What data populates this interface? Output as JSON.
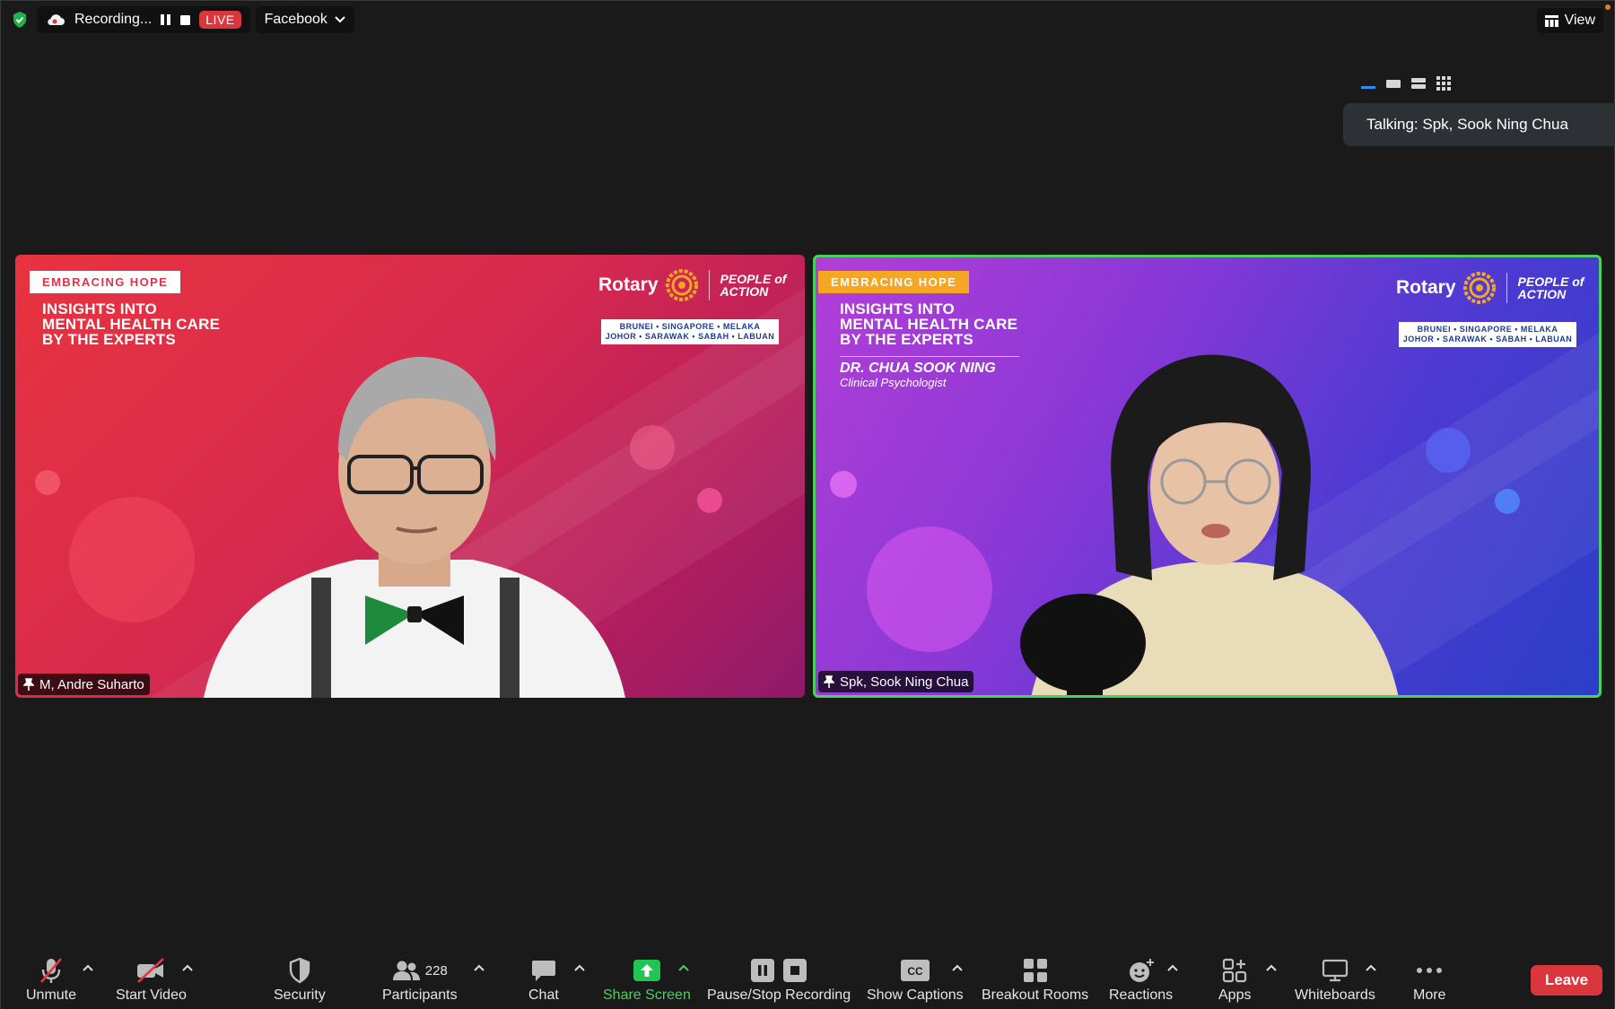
{
  "topbar": {
    "recording_label": "Recording...",
    "live_label": "LIVE",
    "stream_target": "Facebook",
    "view_label": "View"
  },
  "talking": {
    "text": "Talking: Spk, Sook Ning Chua"
  },
  "tiles": [
    {
      "name": "M, Andre Suharto",
      "tag": "EMBRACING HOPE",
      "headline": [
        "INSIGHTS INTO",
        "MENTAL HEALTH CARE",
        "BY THE EXPERTS"
      ],
      "brand": "Rotary",
      "brand_tag": [
        "PEOPLE of",
        "ACTION"
      ],
      "regions": [
        "BRUNEI • SINGAPORE • MELAKA",
        "JOHOR • SARAWAK • SABAH • LABUAN"
      ],
      "active": false
    },
    {
      "name": "Spk, Sook Ning Chua",
      "tag": "EMBRACING HOPE",
      "headline": [
        "INSIGHTS INTO",
        "MENTAL HEALTH CARE",
        "BY THE EXPERTS"
      ],
      "speaker_title": "DR. CHUA SOOK NING",
      "speaker_role": "Clinical Psychologist",
      "brand": "Rotary",
      "brand_tag": [
        "PEOPLE of",
        "ACTION"
      ],
      "regions": [
        "BRUNEI • SINGAPORE • MELAKA",
        "JOHOR • SARAWAK • SABAH • LABUAN"
      ],
      "active": true
    }
  ],
  "toolbar": {
    "unmute": "Unmute",
    "start_video": "Start Video",
    "security": "Security",
    "participants": "Participants",
    "participants_count": "228",
    "chat": "Chat",
    "share_screen": "Share Screen",
    "pause_stop_recording": "Pause/Stop Recording",
    "show_captions": "Show Captions",
    "breakout_rooms": "Breakout Rooms",
    "reactions": "Reactions",
    "apps": "Apps",
    "whiteboards": "Whiteboards",
    "more": "More",
    "leave": "Leave"
  },
  "colors": {
    "live": "#d9363e",
    "active_border": "#4bd05f",
    "share_green": "#4bd05f",
    "leave_red": "#d9363e"
  },
  "icons": [
    "shield-icon",
    "cloud-icon",
    "pause-icon",
    "stop-icon",
    "chevron-down-icon",
    "grid-icon",
    "mic-muted-icon",
    "video-off-icon",
    "security-shield-icon",
    "participants-icon",
    "chat-icon",
    "share-arrow-icon",
    "pause-recording-icon",
    "stop-recording-icon",
    "captions-icon",
    "breakout-rooms-icon",
    "reactions-icon",
    "apps-icon",
    "whiteboard-icon",
    "more-icon",
    "pin-icon"
  ]
}
